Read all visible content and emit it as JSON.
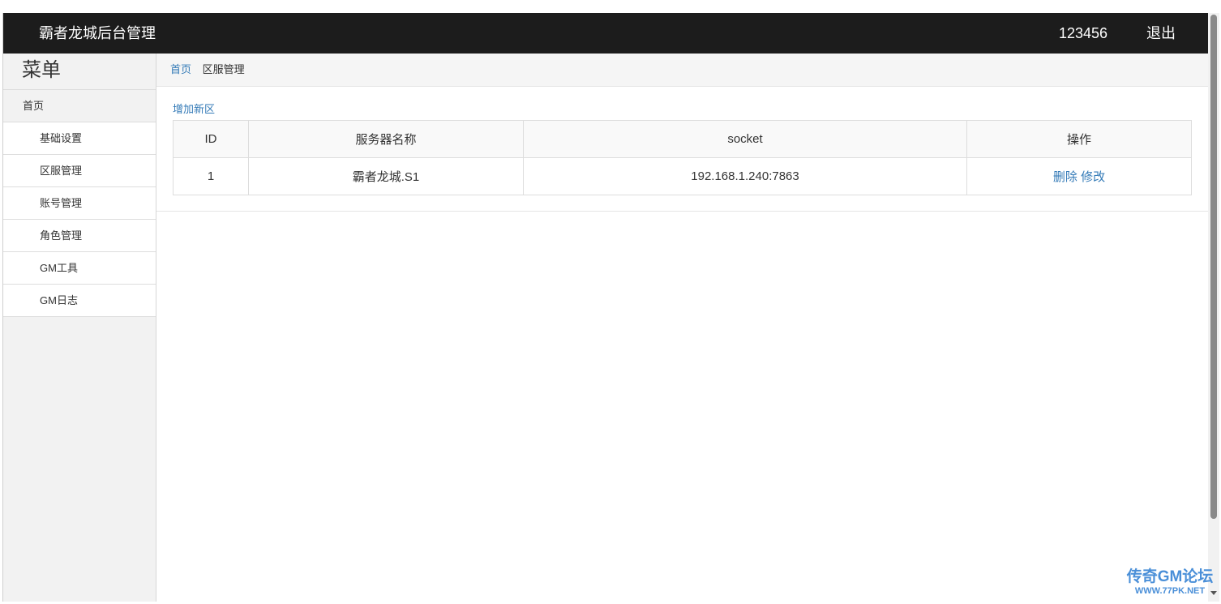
{
  "header": {
    "brand": "霸者龙城后台管理",
    "user": "123456",
    "logout": "退出"
  },
  "sidebar": {
    "title": "菜单",
    "home": "首页",
    "items": [
      {
        "label": "基础设置"
      },
      {
        "label": "区服管理"
      },
      {
        "label": "账号管理"
      },
      {
        "label": "角色管理"
      },
      {
        "label": "GM工具"
      },
      {
        "label": "GM日志"
      }
    ]
  },
  "breadcrumb": {
    "home": "首页",
    "current": "区服管理"
  },
  "content": {
    "add_link": "增加新区",
    "table": {
      "headers": [
        "ID",
        "服务器名称",
        "socket",
        "操作"
      ],
      "rows": [
        {
          "id": "1",
          "name": "霸者龙城.S1",
          "socket": "192.168.1.240:7863",
          "delete": "删除",
          "edit": "修改"
        }
      ]
    }
  },
  "watermark": {
    "line1": "传奇GM论坛",
    "line2": "WWW.77PK.NET"
  },
  "colors": {
    "header_bg": "#1c1c1c",
    "link": "#337ab7",
    "sidebar_bg": "#f2f2f2"
  }
}
